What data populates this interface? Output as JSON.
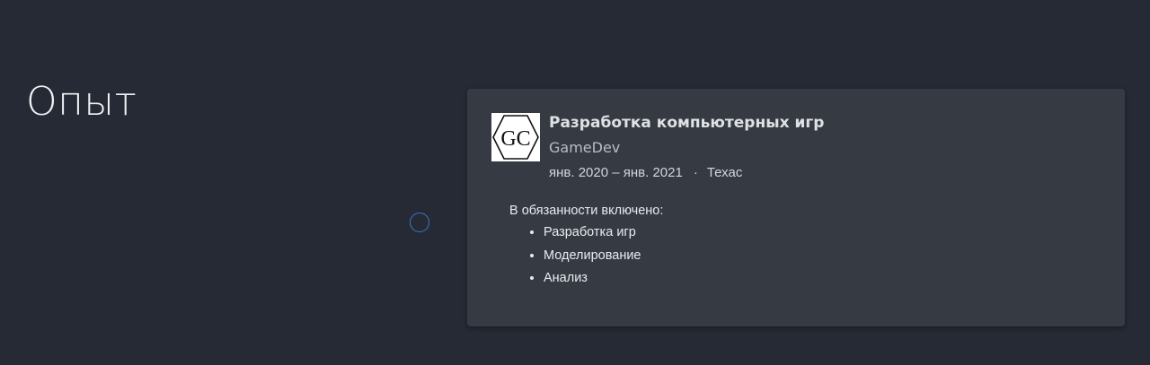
{
  "section": {
    "title": "Опыт"
  },
  "experience": {
    "logo_text": "GC",
    "role": "Разработка компьютерных игр",
    "company": "GameDev",
    "period": "янв. 2020 – янв. 2021",
    "separator": "·",
    "location": "Техас",
    "description_intro": "В обязанности включено:",
    "duties": [
      "Разработка игр",
      "Моделирование",
      "Анализ"
    ]
  },
  "colors": {
    "background": "#262a35",
    "card": "#363a43",
    "timeline_dot": "#3a76c9"
  }
}
